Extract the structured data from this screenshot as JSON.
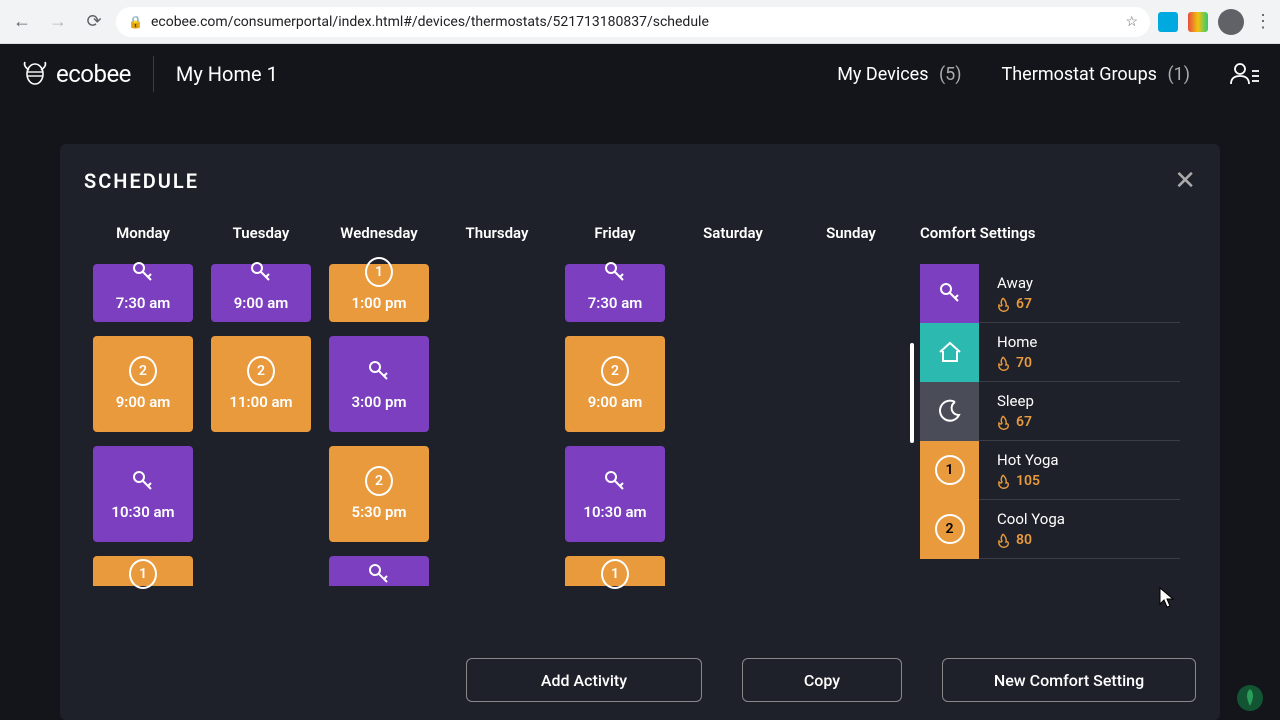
{
  "browser": {
    "url": "ecobee.com/consumerportal/index.html#/devices/thermostats/521713180837/schedule"
  },
  "header": {
    "brand": "ecobee",
    "home_name": "My Home 1",
    "devices_label": "My Devices",
    "devices_count": "(5)",
    "groups_label": "Thermostat Groups",
    "groups_count": "(1)"
  },
  "panel": {
    "title": "SCHEDULE",
    "days": [
      "Monday",
      "Tuesday",
      "Wednesday",
      "Thursday",
      "Friday",
      "Saturday",
      "Sunday"
    ],
    "comfort_heading": "Comfort Settings",
    "buttons": {
      "add": "Add Activity",
      "copy": "Copy",
      "new": "New Comfort Setting"
    }
  },
  "schedule": {
    "mon": [
      {
        "kind": "away",
        "time": "7:30 am",
        "partial": "top"
      },
      {
        "kind": "num",
        "num": "2",
        "time": "9:00 am"
      },
      {
        "kind": "away",
        "time": "10:30 am"
      },
      {
        "kind": "num",
        "num": "1",
        "partial": "bot"
      }
    ],
    "tue": [
      {
        "kind": "away",
        "time": "9:00 am",
        "partial": "top"
      },
      {
        "kind": "num",
        "num": "2",
        "time": "11:00 am"
      }
    ],
    "wed": [
      {
        "kind": "num",
        "num": "1",
        "time": "1:00 pm",
        "partial": "top"
      },
      {
        "kind": "away",
        "time": "3:00 pm"
      },
      {
        "kind": "num",
        "num": "2",
        "time": "5:30 pm"
      },
      {
        "kind": "away",
        "partial": "bot"
      }
    ],
    "fri": [
      {
        "kind": "away",
        "time": "7:30 am",
        "partial": "top"
      },
      {
        "kind": "num",
        "num": "2",
        "time": "9:00 am"
      },
      {
        "kind": "away",
        "time": "10:30 am"
      },
      {
        "kind": "num",
        "num": "1",
        "partial": "bot"
      }
    ]
  },
  "comfort": [
    {
      "name": "Away",
      "temp": "67",
      "swatch": "purple",
      "icon": "key"
    },
    {
      "name": "Home",
      "temp": "70",
      "swatch": "teal",
      "icon": "house"
    },
    {
      "name": "Sleep",
      "temp": "67",
      "swatch": "gray",
      "icon": "moon"
    },
    {
      "name": "Hot Yoga",
      "temp": "105",
      "swatch": "orange",
      "icon": "num",
      "num": "1"
    },
    {
      "name": "Cool Yoga",
      "temp": "80",
      "swatch": "orange",
      "icon": "num",
      "num": "2"
    }
  ]
}
